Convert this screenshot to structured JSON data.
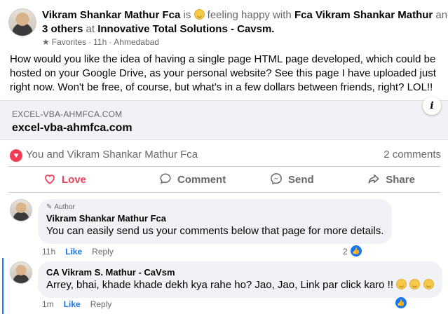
{
  "header": {
    "author": "Vikram Shankar Mathur Fca",
    "is_text": "is",
    "feeling": "feeling happy with",
    "tagged": "Fca Vikram Shankar Mathur",
    "and_text": "and",
    "others": "3 others",
    "at_text": "at",
    "place": "Innovative Total Solutions - Cavsm.",
    "favorites": "Favorites",
    "time": "11h",
    "location": "Ahmedabad"
  },
  "post": {
    "text": "How would you like the idea of having a single page HTML page developed, which could be hosted on your Google Drive, as your personal website? See this page I have uploaded just right now. Won't be free, of course, but what's in a few dollars between friends, right? LOL!!"
  },
  "link_card": {
    "domain": "EXCEL-VBA-AHMFCA.COM",
    "title": "excel-vba-ahmfca.com",
    "info": "i"
  },
  "reactions": {
    "names": "You and Vikram Shankar Mathur Fca",
    "comment_count": "2 comments"
  },
  "actions": {
    "love": "Love",
    "comment": "Comment",
    "send": "Send",
    "share": "Share"
  },
  "comments": [
    {
      "badge": "Author",
      "name": "Vikram Shankar Mathur Fca",
      "text": "You can easily send us your comments below that page for more details.",
      "time": "11h",
      "like": "Like",
      "reply": "Reply",
      "likes": "2"
    },
    {
      "name": "CA Vikram S. Mathur - CaVsm",
      "text": "Arrey, bhai, khade khade dekh kya rahe ho? Jao, Jao, Link par click karo !!",
      "time": "1m",
      "like": "Like",
      "reply": "Reply"
    }
  ],
  "icons": {
    "star": "star-icon",
    "globe": "globe-icon",
    "pencil": "pencil-icon",
    "heart": "heart-icon",
    "thumbs_up": "thumbs-up-icon",
    "smile": "smile-emoji-icon"
  },
  "colors": {
    "love": "#f33e58",
    "link": "#1877f2",
    "muted": "#65676b",
    "bubble": "#f0f2f5"
  }
}
